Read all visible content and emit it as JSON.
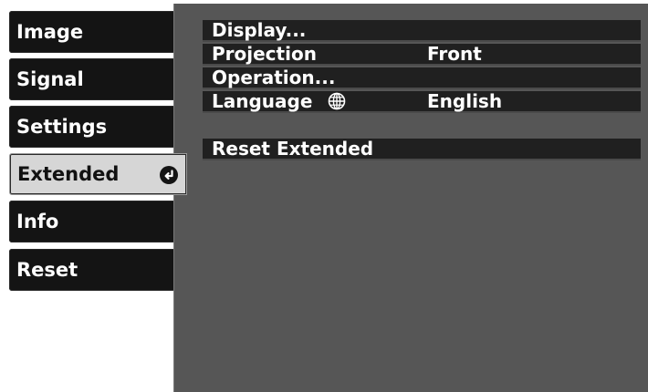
{
  "sidebar": {
    "tabs": [
      {
        "label": "Image"
      },
      {
        "label": "Signal"
      },
      {
        "label": "Settings"
      },
      {
        "label": "Extended",
        "selected": true,
        "icon": "enter-icon"
      },
      {
        "label": "Info"
      },
      {
        "label": "Reset"
      }
    ]
  },
  "panel": {
    "items": [
      {
        "label": "Display..."
      },
      {
        "label": "Projection",
        "value": "Front"
      },
      {
        "label": "Operation..."
      },
      {
        "label": "Language",
        "icon": "globe-icon",
        "value": "English"
      },
      {
        "label": "Reset Extended"
      }
    ]
  },
  "colors": {
    "tab_background": "#141414",
    "tab_selected_background": "#d6d6d6",
    "panel_background": "#565656",
    "row_background": "#202020",
    "text": "#ffffff"
  }
}
